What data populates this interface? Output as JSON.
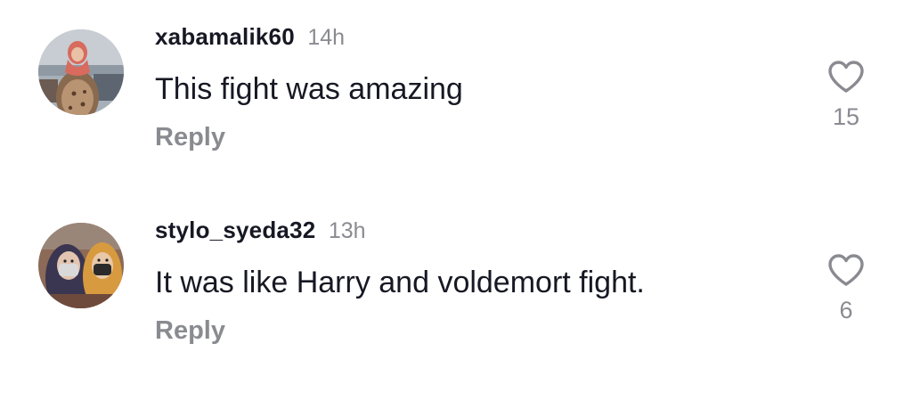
{
  "comments": [
    {
      "username": "xabamalik60",
      "time": "14h",
      "text": "This fight was amazing",
      "reply_label": "Reply",
      "like_count": "15",
      "icon": "heart-outline-icon"
    },
    {
      "username": "stylo_syeda32",
      "time": "13h",
      "text": "It was like Harry and voldemort fight.",
      "reply_label": "Reply",
      "like_count": "6",
      "icon": "heart-outline-icon"
    }
  ],
  "colors": {
    "primary_text": "#161823",
    "secondary_text": "#8a8b91",
    "background": "#ffffff"
  }
}
